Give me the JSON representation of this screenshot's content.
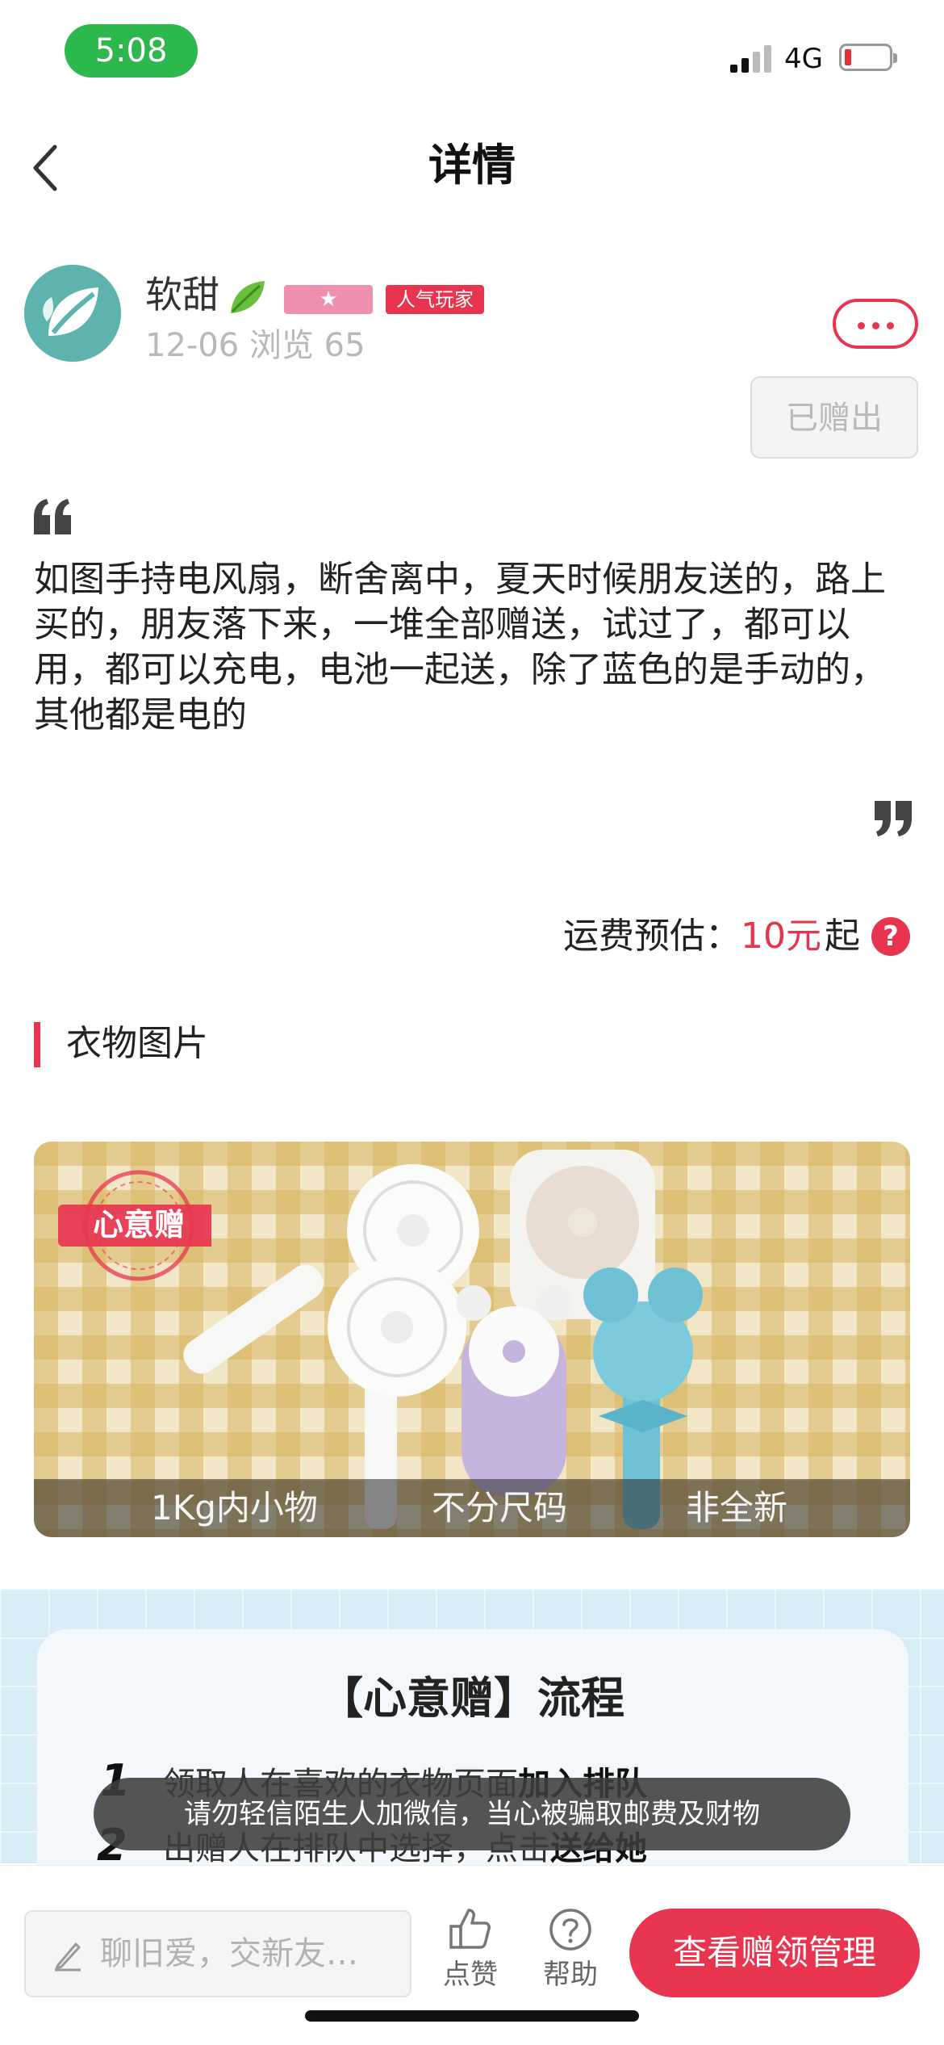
{
  "status_bar": {
    "time": "5:08",
    "network": "4G"
  },
  "nav": {
    "title": "详情"
  },
  "user": {
    "name": "软甜",
    "badge_star": "★",
    "badge_popular": "人气玩家",
    "meta": "12-06 浏览 65",
    "given_label": "已赠出"
  },
  "post": {
    "description": "如图手持电风扇，断舍离中，夏天时候朋友送的，路上买的，朋友落下来，一堆全部赠送，试过了，都可以用，都可以充电，电池一起送，除了蓝色的是手动的，其他都是电的"
  },
  "shipping": {
    "label": "运费预估：",
    "price": "10元",
    "suffix": "起",
    "help_glyph": "?"
  },
  "section": {
    "title": "衣物图片"
  },
  "photo": {
    "stamp_text": "心意赠",
    "tags": [
      "1Kg内小物",
      "不分尺码",
      "非全新"
    ]
  },
  "flow": {
    "title": "【心意赠】流程",
    "steps": [
      {
        "num": "1",
        "text": "领取人在喜欢的衣物页面",
        "bold": "加入排队"
      },
      {
        "num": "2",
        "text": "出赠人在排队中选择，点击",
        "bold": "送给她"
      }
    ]
  },
  "toast": {
    "text": "请勿轻信陌生人加微信，当心被骗取邮费及财物"
  },
  "bottom_bar": {
    "chat_placeholder": "聊旧爱，交新友…",
    "like_label": "点赞",
    "help_label": "帮助",
    "cta_label": "查看赠领管理"
  },
  "colors": {
    "accent": "#e8344f",
    "status_green": "#2db84d",
    "flow_bg": "#d7ecf5"
  },
  "icons": [
    "back-arrow-icon",
    "leaf-icon",
    "more-dots-icon",
    "quote-open-icon",
    "quote-close-icon",
    "help-circle-icon",
    "pencil-icon",
    "thumbs-up-icon",
    "question-icon"
  ]
}
